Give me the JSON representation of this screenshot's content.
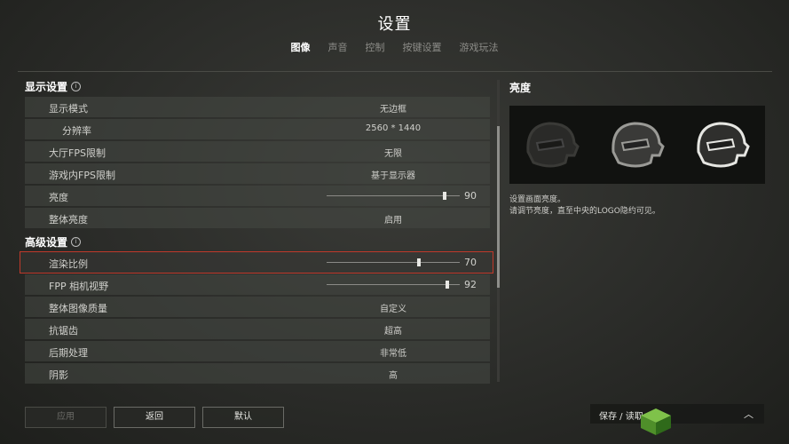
{
  "title": "设置",
  "tabs": [
    "图像",
    "声音",
    "控制",
    "按键设置",
    "游戏玩法"
  ],
  "display_section": {
    "title": "显示设置",
    "rows": [
      {
        "label": "显示模式",
        "value": "无边框"
      },
      {
        "label": "分辨率",
        "value": "2560 * 1440"
      },
      {
        "label": "大厅FPS限制",
        "value": "无限"
      },
      {
        "label": "游戏内FPS限制",
        "value": "基于显示器"
      },
      {
        "label": "亮度",
        "slider": 90
      },
      {
        "label": "整体亮度",
        "value": "启用"
      }
    ]
  },
  "advanced_section": {
    "title": "高级设置",
    "rows": [
      {
        "label": "渲染比例",
        "slider": 70
      },
      {
        "label": "FPP 相机视野",
        "slider": 92
      },
      {
        "label": "整体图像质量",
        "value": "自定义"
      },
      {
        "label": "抗锯齿",
        "value": "超高"
      },
      {
        "label": "后期处理",
        "value": "非常低"
      },
      {
        "label": "阴影",
        "value": "高"
      }
    ]
  },
  "preview": {
    "title": "亮度",
    "desc1": "设置画面亮度。",
    "desc2": "请调节亮度，直至中央的LOGO隐约可见。"
  },
  "buttons": {
    "apply": "应用",
    "back": "返回",
    "default": "默认"
  },
  "save_load": "保存 / 读取"
}
